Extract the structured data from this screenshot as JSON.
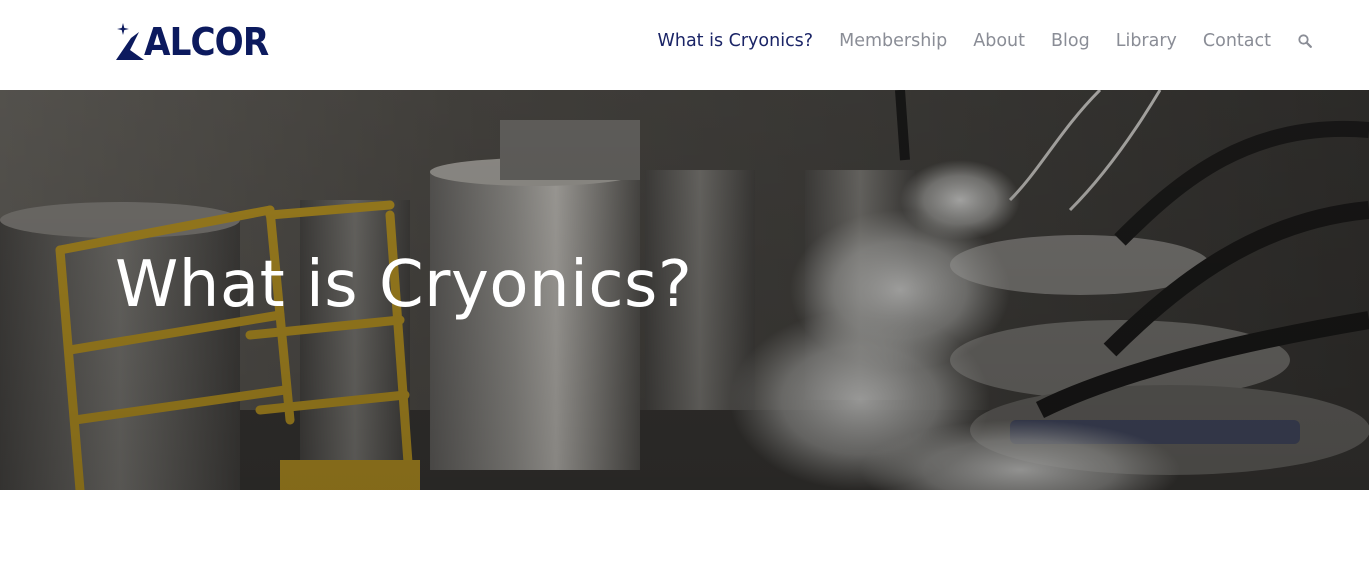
{
  "header": {
    "logo_text": "ALCOR",
    "brand_color": "#0c1a5e"
  },
  "nav": {
    "items": [
      {
        "label": "What is Cryonics?",
        "active": true
      },
      {
        "label": "Membership",
        "active": false
      },
      {
        "label": "About",
        "active": false
      },
      {
        "label": "Blog",
        "active": false
      },
      {
        "label": "Library",
        "active": false
      },
      {
        "label": "Contact",
        "active": false
      }
    ],
    "search_icon": "search-icon",
    "active_color": "#1a2466",
    "inactive_color": "#8a8d96"
  },
  "hero": {
    "title": "What is Cryonics?",
    "image": "cryonics-storage-dewars-photo"
  }
}
